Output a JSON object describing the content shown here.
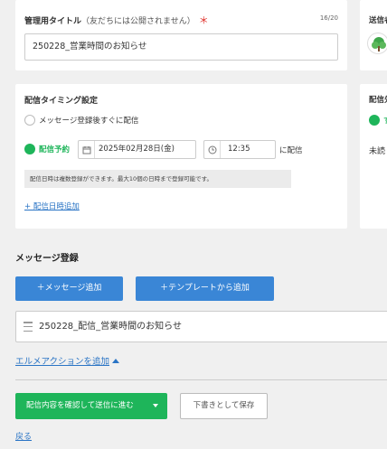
{
  "title_section": {
    "label": "管理用タイトル",
    "note": "（友だちには公開されません）",
    "required_mark": "＊",
    "counter": "16/20",
    "value": "250228_営業時間のお知らせ"
  },
  "timing_section": {
    "label": "配信タイミング設定",
    "option_immediate": "メッセージ登録後すぐに配信",
    "option_scheduled": "配信予約",
    "selected_option": "配信予約",
    "date_value": "2025年02月28日(金)",
    "time_value": "12:35",
    "suffix": "に配信",
    "info_note": "配信日時は複数登録ができます。最大10個の日時まで登録可能です。",
    "add_datetime_link": "+ 配信日時追加"
  },
  "right_panel": {
    "sender_label": "送信者",
    "target_label": "配信先",
    "target_option_glyph": "す",
    "target_text": "未読"
  },
  "message_section": {
    "heading": "メッセージ登録",
    "add_message_button": "＋メッセージ追加",
    "add_template_button": "＋テンプレートから追加",
    "messages": [
      {
        "text": "250228_配信_営業時間のお知らせ"
      }
    ],
    "elme_action_link": "エルメアクションを追加"
  },
  "footer": {
    "confirm_button": "配信内容を確認して送信に進む",
    "draft_button": "下書きとして保存",
    "back_link": "戻る"
  },
  "colors": {
    "accent_green": "#1eb55a",
    "accent_blue": "#3a86d6",
    "link_blue": "#2a74c5",
    "required_red": "#e0312b"
  },
  "icons": [
    "calendar-icon",
    "clock-icon",
    "drag-handle-icon",
    "caret-up-icon",
    "caret-down-icon",
    "logo-icon"
  ]
}
